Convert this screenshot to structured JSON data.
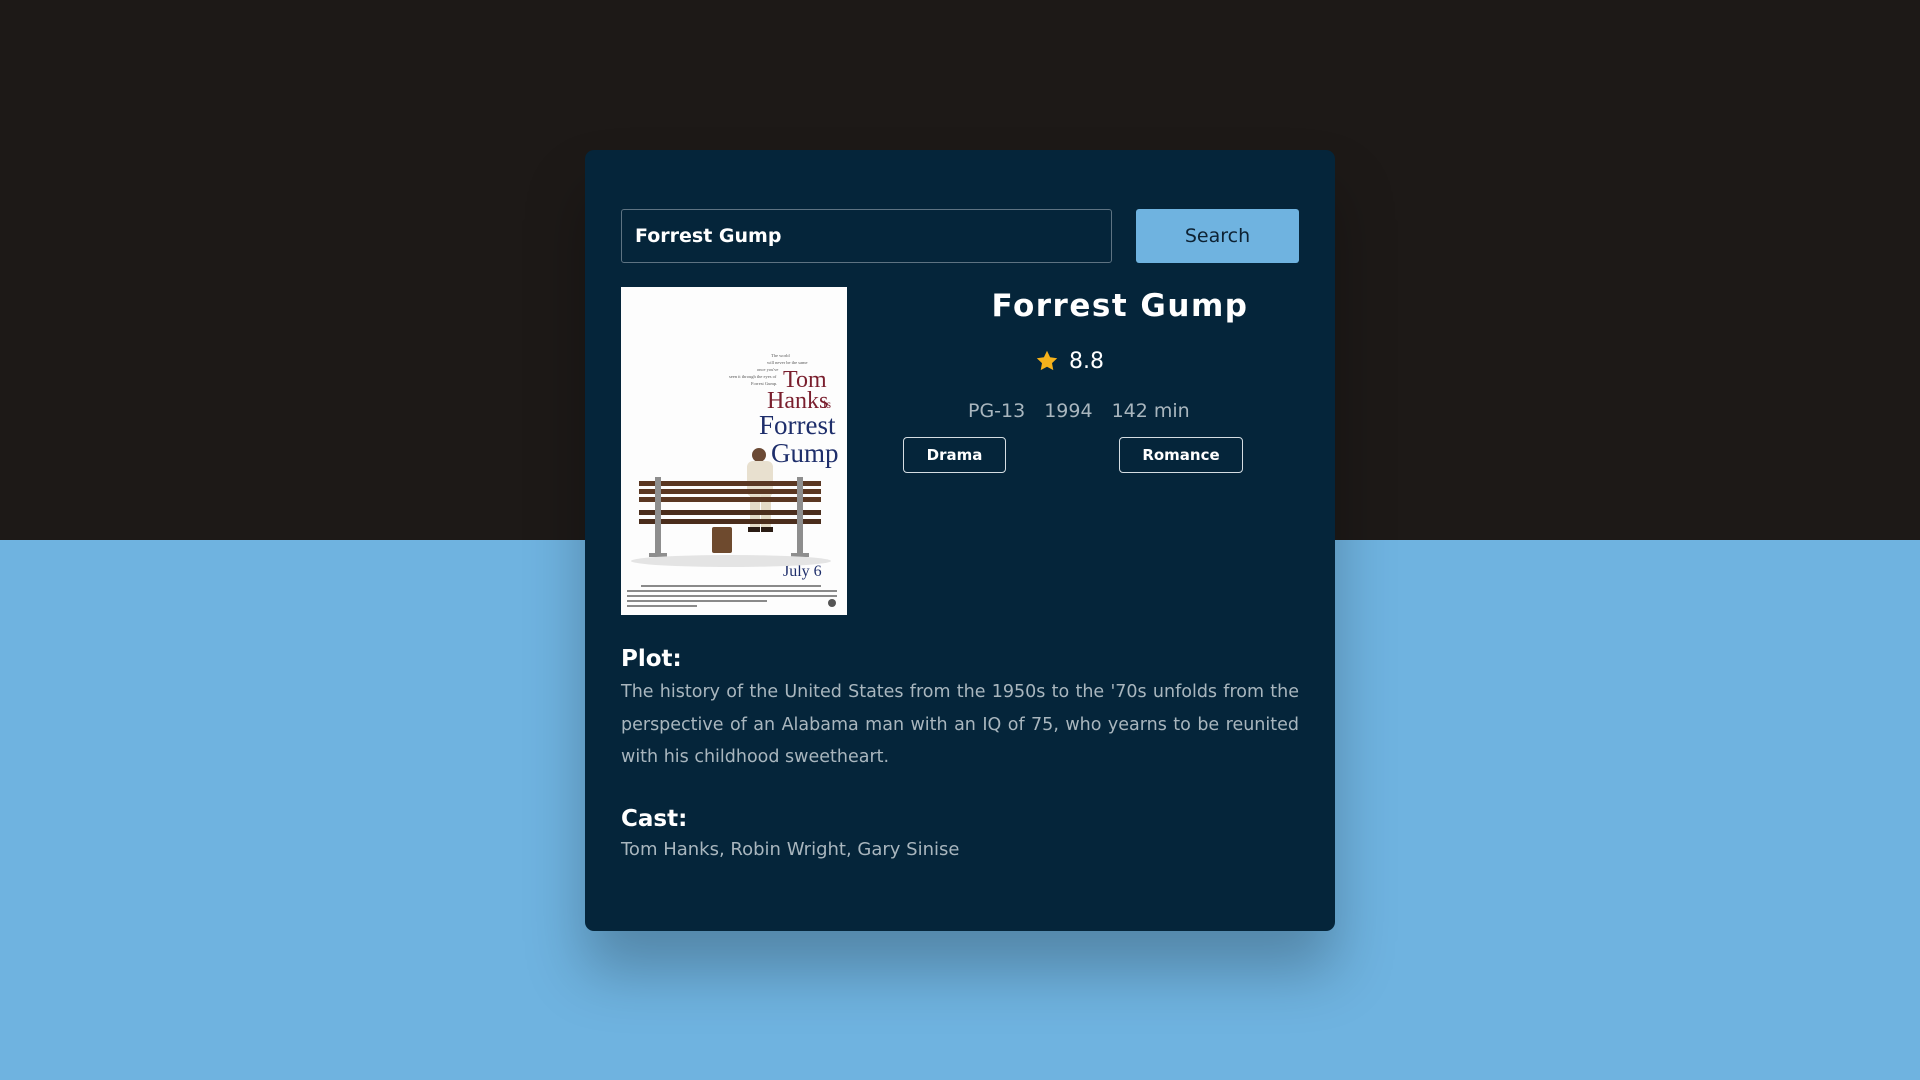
{
  "search": {
    "value": "Forrest Gump",
    "button_label": "Search"
  },
  "movie": {
    "title": "Forrest Gump",
    "rating": "8.8",
    "rated": "PG-13",
    "year": "1994",
    "runtime": "142 min",
    "genres": [
      "Drama",
      "Romance"
    ],
    "plot_heading": "Plot:",
    "plot": "The history of the United States from the 1950s to the '70s unfolds from the perspective of an Alabama man with an IQ of 75, who yearns to be reunited with his childhood sweetheart.",
    "cast_heading": "Cast:",
    "cast": "Tom Hanks, Robin Wright, Gary Sinise"
  },
  "poster": {
    "tagline": "The world will never be the same once you've seen it through the eyes of Forrest Gump.",
    "line1": "Tom",
    "line2": "Hanks",
    "line2_suffix": "is",
    "line3": "Forrest",
    "line4": "Gump",
    "release": "July 6"
  },
  "colors": {
    "background_top": "#1d1917",
    "background_bottom": "#6fb3e0",
    "card": "#05253a",
    "accent": "#6fb3e0",
    "star": "#f5b21b"
  },
  "icons": {
    "rating": "star-icon"
  }
}
